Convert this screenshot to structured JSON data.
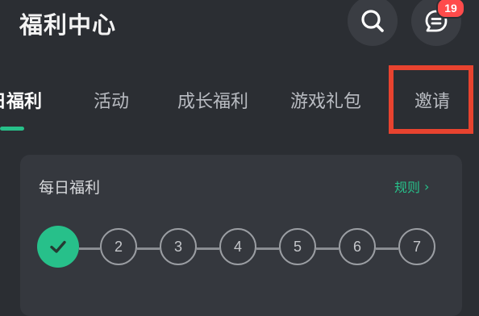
{
  "header": {
    "title": "福利中心",
    "badge_count": "19"
  },
  "tabs": [
    {
      "label": "日福利",
      "active": true
    },
    {
      "label": "活动",
      "active": false
    },
    {
      "label": "成长福利",
      "active": false
    },
    {
      "label": "游戏礼包",
      "active": false
    },
    {
      "label": "邀请",
      "active": false
    }
  ],
  "card": {
    "title": "每日福利",
    "rules_label": "规则"
  },
  "steps": [
    {
      "label": "",
      "done": true
    },
    {
      "label": "2",
      "done": false
    },
    {
      "label": "3",
      "done": false
    },
    {
      "label": "4",
      "done": false
    },
    {
      "label": "5",
      "done": false
    },
    {
      "label": "6",
      "done": false
    },
    {
      "label": "7",
      "done": false
    }
  ],
  "colors": {
    "background": "#2b2e33",
    "accent": "#27c08a",
    "badge": "#ff4b4b",
    "highlight": "#e8432f"
  },
  "icons": {
    "search": "search-icon",
    "message": "message-icon",
    "rules": "chevron-right-icon",
    "check": "check-icon"
  }
}
